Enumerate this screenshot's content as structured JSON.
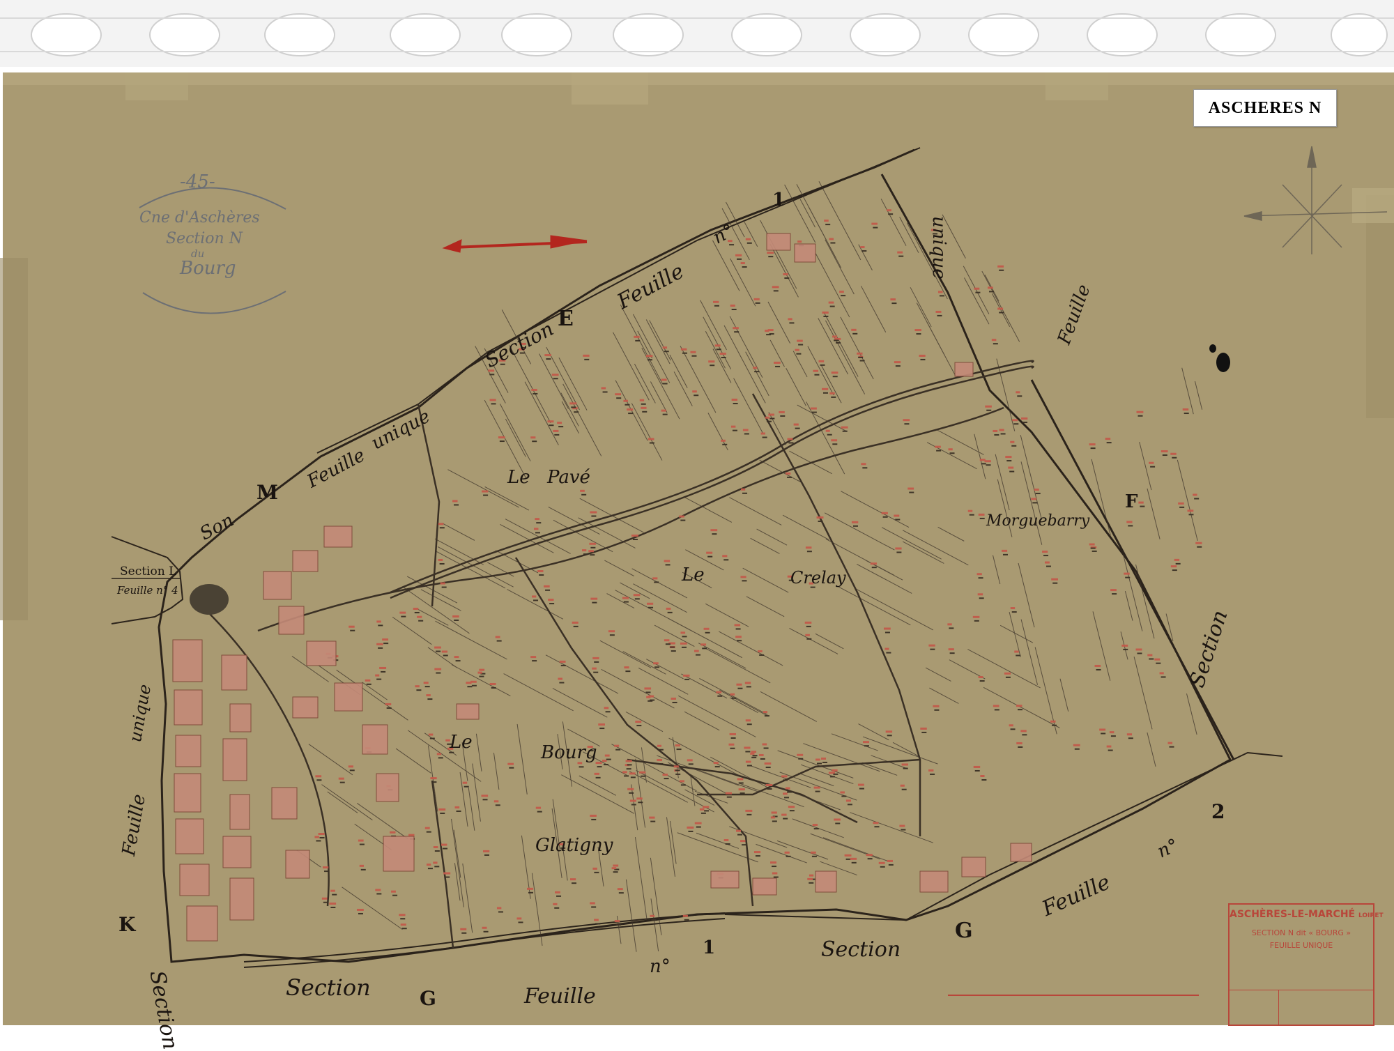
{
  "sheet_tag": "ASCHERES  N",
  "colors": {
    "paper": "#a99a72",
    "ink": "#2b231b",
    "parcel_red": "#c25a4a",
    "arrow_red": "#b3261e",
    "building_fill": "#c48a78"
  },
  "title_cartouche": {
    "number": "-45-",
    "line1": "Cne d'Aschères",
    "line2": "Section N",
    "line3": "du",
    "line4": "Bourg"
  },
  "neighbors": {
    "section_e_word": "Section",
    "section_e_letter": "E",
    "section_e_feuille": "Feuille",
    "section_e_no": "n°",
    "section_e_num": "1",
    "section_m_prefix": "Son",
    "section_m_letter": "M",
    "section_m_feuille": "Feuille",
    "section_m_unique": "unique",
    "right_unique": "unique",
    "right_feuille": "Feuille",
    "right_letter": "F",
    "right_section": "Section",
    "bottom_right_feuille": "Feuille",
    "bottom_right_no": "n°",
    "bottom_right_num": "2",
    "bottom_g_letter": "G",
    "bottom_section": "Section",
    "bottom_no": "n°",
    "bottom_num": "1",
    "bottom_left_section": "Section",
    "bottom_left_g": "G",
    "bottom_left_feuille": "Feuille",
    "section_l_line1": "Section L",
    "section_l_line2": "Feuille n° 4",
    "left_feuille": "Feuille",
    "left_unique": "unique",
    "left_k": "K",
    "left_section": "Section"
  },
  "place_names": {
    "le_pave_1": "Le",
    "le_pave_2": "Pavé",
    "le_crelay_1": "Le",
    "le_crelay_2": "Crelay",
    "morgueberry": "Morguebarry",
    "le_bourg_1": "Le",
    "le_bourg_2": "Bourg",
    "glatigny": "Glatigny"
  },
  "footer_cartouche": {
    "title": "ASCHÈRES-LE-MARCHÉ",
    "dept": "LOIRET",
    "section": "SECTION N  dit « BOURG »",
    "feuille": "FEUILLE  UNIQUE"
  }
}
